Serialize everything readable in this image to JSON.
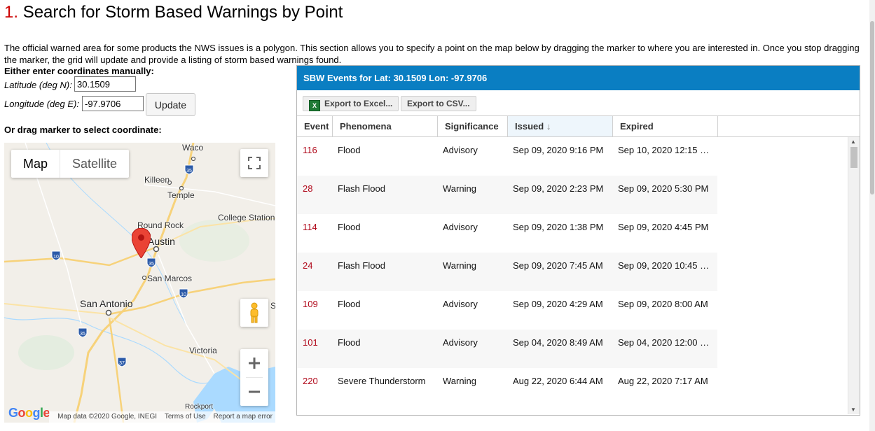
{
  "page": {
    "title_number": "1.",
    "title": "Search for Storm Based Warnings by Point",
    "intro": "The official warned area for some products the NWS issues is a polygon. This section allows you to specify a point on the map below by dragging the marker to where you are interested in. Once you stop dragging the marker, the grid will update and provide a listing of storm based warnings found."
  },
  "form": {
    "manual_heading": "Either enter coordinates manually:",
    "lat_label": "Latitude (deg N):",
    "lat_value": "30.1509",
    "lon_label": "Longitude (deg E):",
    "lon_value": "-97.9706",
    "update_label": "Update",
    "drag_heading": "Or drag marker to select coordinate:"
  },
  "map": {
    "type_map": "Map",
    "type_satellite": "Satellite",
    "logo": "Google",
    "attribution": "Map data ©2020 Google, INEGI",
    "terms": "Terms of Use",
    "report": "Report a map error",
    "labels": {
      "waco": "Waco",
      "killeen": "Killeen",
      "temple": "Temple",
      "college_station": "College Station",
      "round_rock": "Round Rock",
      "austin": "Austin",
      "san_marcos": "San Marcos",
      "san_antonio": "San Antonio",
      "victoria": "Victoria",
      "rockport": "Rockport",
      "edge_s": "S"
    },
    "shields": [
      "35",
      "10",
      "35",
      "10",
      "35",
      "37"
    ],
    "colors": {
      "water": "#aadaff",
      "land": "#f2efe9",
      "highway": "#f7d27a",
      "marker": "#ea4335"
    }
  },
  "grid": {
    "header_title": "SBW Events for Lat: 30.1509 Lon: -97.9706",
    "export_excel": "Export to Excel...",
    "export_csv": "Export to CSV...",
    "columns": {
      "event": "Event",
      "phenomena": "Phenomena",
      "significance": "Significance",
      "issued": "Issued",
      "expired": "Expired"
    },
    "sort_indicator": "↓",
    "rows": [
      {
        "event": "116",
        "phenomena": "Flood",
        "significance": "Advisory",
        "issued": "Sep 09, 2020 9:16 PM",
        "expired": "Sep 10, 2020 12:15 …"
      },
      {
        "event": "28",
        "phenomena": "Flash Flood",
        "significance": "Warning",
        "issued": "Sep 09, 2020 2:23 PM",
        "expired": "Sep 09, 2020 5:30 PM"
      },
      {
        "event": "114",
        "phenomena": "Flood",
        "significance": "Advisory",
        "issued": "Sep 09, 2020 1:38 PM",
        "expired": "Sep 09, 2020 4:45 PM"
      },
      {
        "event": "24",
        "phenomena": "Flash Flood",
        "significance": "Warning",
        "issued": "Sep 09, 2020 7:45 AM",
        "expired": "Sep 09, 2020 10:45 …"
      },
      {
        "event": "109",
        "phenomena": "Flood",
        "significance": "Advisory",
        "issued": "Sep 09, 2020 4:29 AM",
        "expired": "Sep 09, 2020 8:00 AM"
      },
      {
        "event": "101",
        "phenomena": "Flood",
        "significance": "Advisory",
        "issued": "Sep 04, 2020 8:49 AM",
        "expired": "Sep 04, 2020 12:00 …"
      },
      {
        "event": "220",
        "phenomena": "Severe Thunderstorm",
        "significance": "Warning",
        "issued": "Aug 22, 2020 6:44 AM",
        "expired": "Aug 22, 2020 7:17 AM"
      }
    ]
  }
}
